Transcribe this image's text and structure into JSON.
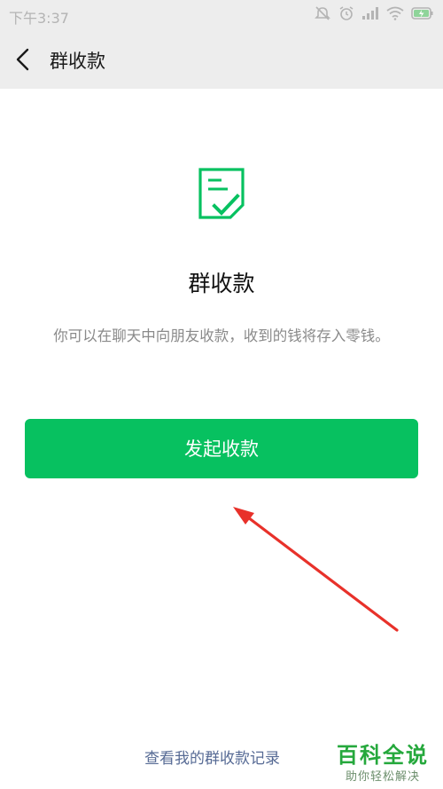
{
  "status_bar": {
    "time": "下午3:37",
    "icons": [
      "mute-icon",
      "alarm-icon",
      "signal-icon",
      "wifi-icon",
      "battery-charging-icon"
    ]
  },
  "nav": {
    "back_icon": "chevron-left-icon",
    "title": "群收款"
  },
  "hero": {
    "icon": "document-check-icon",
    "title": "群收款",
    "description": "你可以在聊天中向朋友收款，收到的钱将存入零钱。"
  },
  "actions": {
    "primary_label": "发起收款",
    "records_link": "查看我的群收款记录"
  },
  "watermark": {
    "title": "百科全说",
    "subtitle": "助你轻松解决"
  },
  "colors": {
    "accent": "#07c160",
    "link": "#576b95",
    "annotation_arrow": "#e8312a"
  }
}
